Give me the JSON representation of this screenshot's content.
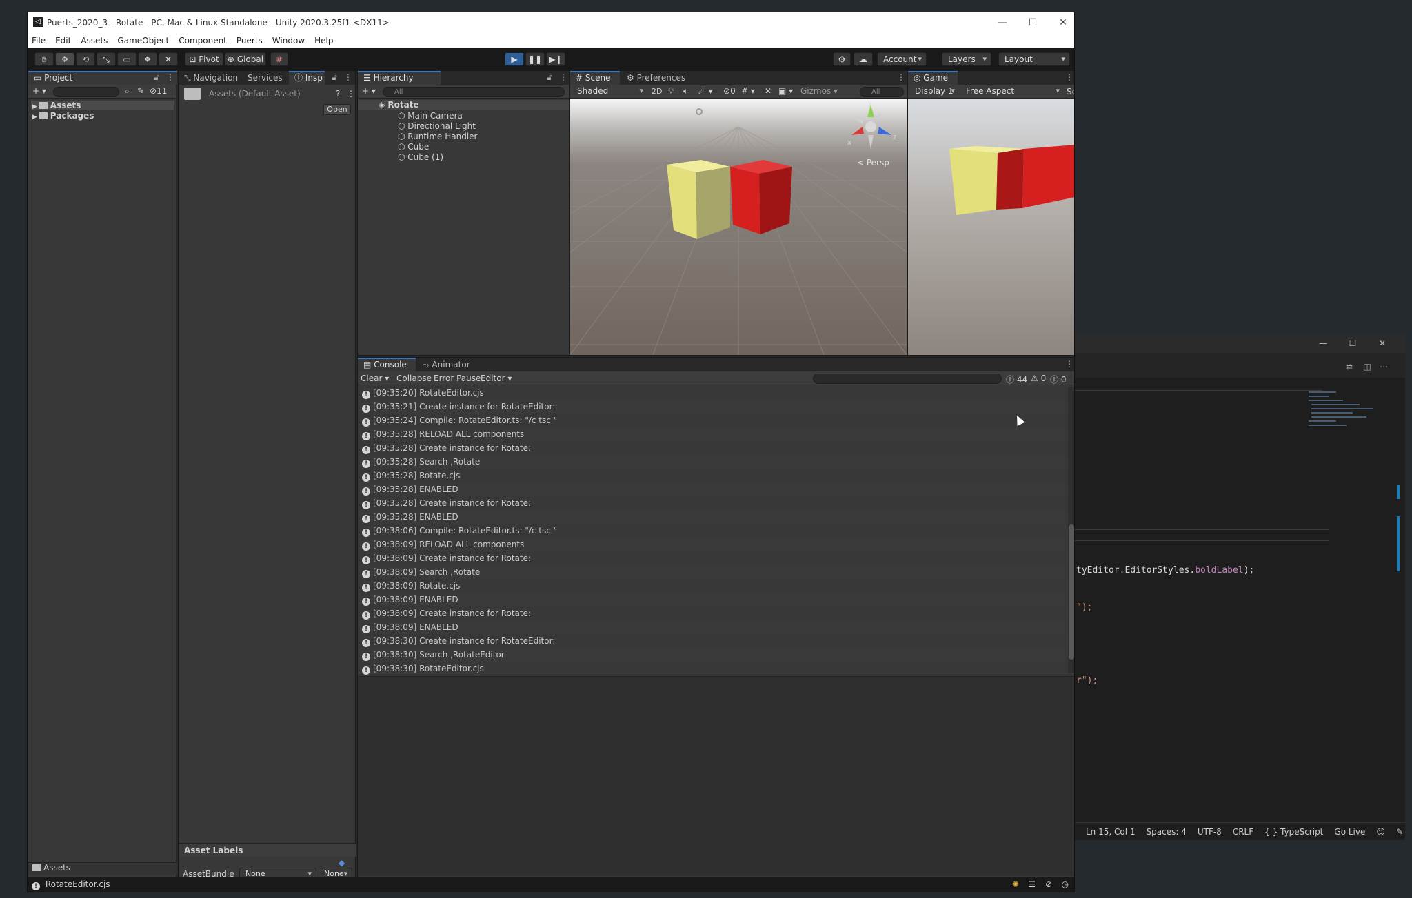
{
  "unity": {
    "title": "Puerts_2020_3 - Rotate - PC, Mac & Linux Standalone - Unity 2020.3.25f1 <DX11>",
    "menu": [
      "File",
      "Edit",
      "Assets",
      "GameObject",
      "Component",
      "Puerts",
      "Window",
      "Help"
    ],
    "toolbar": {
      "pivot_label": "Pivot",
      "global_label": "Global",
      "account_label": "Account",
      "layers_label": "Layers",
      "layout_label": "Layout"
    },
    "project": {
      "tab": "Project",
      "hidden_count": "11",
      "tree": [
        "Assets",
        "Packages"
      ],
      "footer_path": "Assets"
    },
    "inspector": {
      "tabs": [
        "Navigation",
        "Services",
        "Insp"
      ],
      "asset_title": "Assets (Default Asset)",
      "open_label": "Open",
      "asset_labels_header": "Asset Labels",
      "assetbundle_label": "AssetBundle",
      "assetbundle_value": "None",
      "variant_value": "None"
    },
    "hierarchy": {
      "tab": "Hierarchy",
      "search_placeholder": "All",
      "scene_name": "Rotate",
      "objects": [
        "Main Camera",
        "Directional Light",
        "Runtime Handler",
        "Cube",
        "Cube (1)"
      ]
    },
    "scene": {
      "tabs": [
        "Scene",
        "Preferences"
      ],
      "shading": "Shaded",
      "mode_2d": "2D",
      "hidden_count": "0",
      "gizmos_label": "Gizmos",
      "search_placeholder": "All",
      "persp_label": "< Persp",
      "axis_y": "y",
      "axis_x": "x",
      "axis_z": "z"
    },
    "game": {
      "tab": "Game",
      "display": "Display 1",
      "aspect": "Free Aspect",
      "scale_label": "Sc"
    },
    "console": {
      "tabs": [
        "Console",
        "Animator"
      ],
      "clear_label": "Clear",
      "collapse_label": "Collapse",
      "error_pause_label": "Error Pause",
      "editor_label": "Editor",
      "count_info": "44",
      "count_warn": "0",
      "count_error": "0",
      "rows": [
        "[09:35:20] RotateEditor.cjs",
        "[09:35:21] Create instance for RotateEditor:",
        "[09:35:24] Compile: RotateEditor.ts: \"/c tsc \"",
        "[09:35:28] RELOAD ALL components",
        "[09:35:28] Create instance for Rotate:",
        "[09:35:28] Search ,Rotate",
        "[09:35:28] Rotate.cjs",
        "[09:35:28] ENABLED",
        "[09:35:28] Create instance for Rotate:",
        "[09:35:28] ENABLED",
        "[09:38:06] Compile: RotateEditor.ts: \"/c tsc \"",
        "[09:38:09] RELOAD ALL components",
        "[09:38:09] Create instance for Rotate:",
        "[09:38:09] Search ,Rotate",
        "[09:38:09] Rotate.cjs",
        "[09:38:09] ENABLED",
        "[09:38:09] Create instance for Rotate:",
        "[09:38:09] ENABLED",
        "[09:38:30] Create instance for RotateEditor:",
        "[09:38:30] Search ,RotateEditor",
        "[09:38:30] RotateEditor.cjs"
      ]
    },
    "status_message": "RotateEditor.cjs"
  },
  "vscode": {
    "code_lines": {
      "l1_prefix": "tyEditor.EditorStyles.",
      "l1_prop": "boldLabel",
      "l1_suffix": ");",
      "l2": "\");",
      "l3": "r\");"
    },
    "status": [
      "Ln 15, Col 1",
      "Spaces: 4",
      "UTF-8",
      "CRLF",
      "{ } TypeScript",
      "Go Live"
    ]
  },
  "colors": {
    "unity_accent": "#3a79bb",
    "cube_yellow": "#e3e07c",
    "cube_red": "#d62020",
    "vscode_string": "#ce9178",
    "vscode_property": "#c586c0"
  }
}
